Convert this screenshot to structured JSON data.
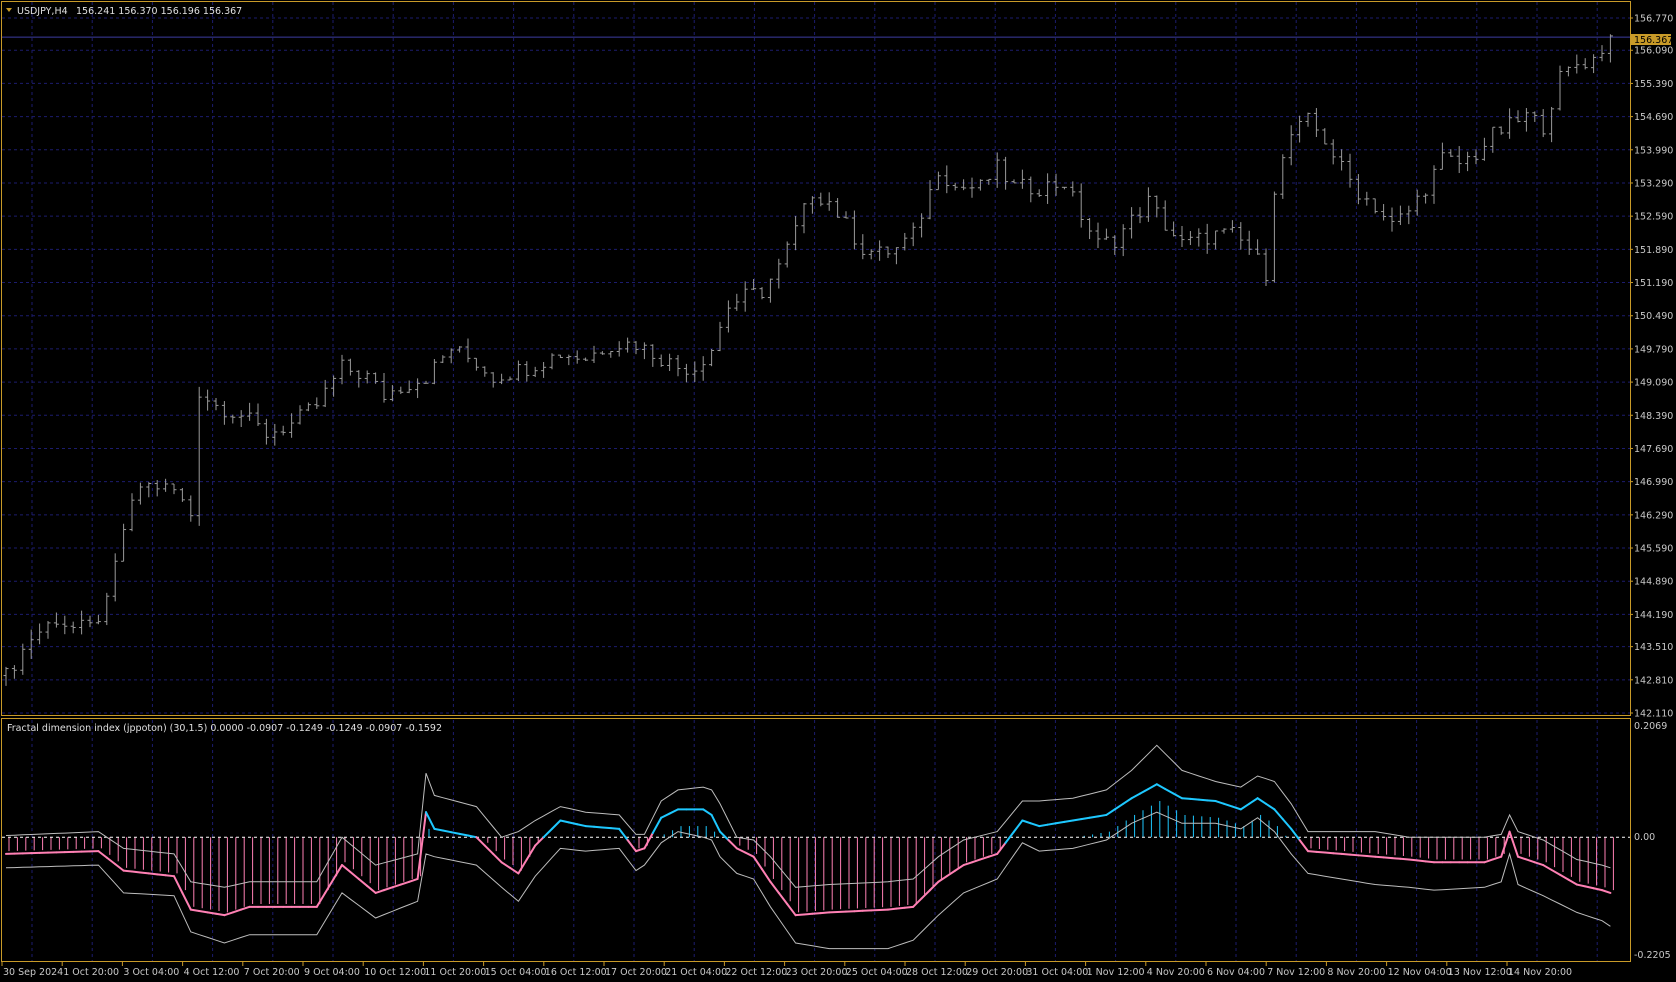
{
  "main": {
    "symbol": "USDJPY,H4",
    "ohlc": "156.241 156.370 156.196 156.367",
    "current_price": "156.367",
    "price_ticks": [
      "156.770",
      "156.090",
      "155.390",
      "154.690",
      "153.990",
      "153.290",
      "152.590",
      "151.890",
      "151.190",
      "150.490",
      "149.790",
      "149.090",
      "148.390",
      "147.690",
      "146.990",
      "146.290",
      "145.590",
      "144.890",
      "144.190",
      "143.510",
      "142.810",
      "142.110"
    ]
  },
  "indicator": {
    "title": "Fractal dimension index (jppoton) (30,1.5) 0.0000 -0.0907 -0.1249 -0.1249 -0.0907 -0.1592",
    "max_label": "0.2069",
    "zero_label": "0.00",
    "min_label": "-0.2205"
  },
  "time_labels": [
    "30 Sep 2024",
    "1 Oct 20:00",
    "3 Oct 04:00",
    "4 Oct 12:00",
    "7 Oct 20:00",
    "9 Oct 04:00",
    "10 Oct 12:00",
    "11 Oct 20:00",
    "15 Oct 04:00",
    "16 Oct 12:00",
    "17 Oct 20:00",
    "21 Oct 04:00",
    "22 Oct 12:00",
    "23 Oct 20:00",
    "25 Oct 04:00",
    "28 Oct 12:00",
    "29 Oct 20:00",
    "31 Oct 04:00",
    "1 Nov 12:00",
    "4 Nov 20:00",
    "6 Nov 04:00",
    "7 Nov 12:00",
    "8 Nov 20:00",
    "12 Nov 04:00",
    "13 Nov 12:00",
    "14 Nov 20:00"
  ],
  "colors": {
    "background": "#000000",
    "frame": "#c89a28",
    "grid": "#1c1c6e",
    "bars": "#9a9a9a",
    "bid_line": "#3c3ca0",
    "price_tag": "#c89a28",
    "fdi_positive": "#1ec8ff",
    "fdi_negative": "#ff80b4",
    "bands": "#bdbdbd",
    "zero_line": "#ffffff"
  },
  "chart_data": [
    {
      "type": "bar",
      "title": "USDJPY,H4",
      "ylim": [
        142.11,
        156.77
      ],
      "grid": true,
      "close_anchors": [
        [
          0,
          142.9
        ],
        [
          3,
          143.7
        ],
        [
          6,
          144.1
        ],
        [
          8,
          143.9
        ],
        [
          10,
          143.9
        ],
        [
          12,
          144.4
        ],
        [
          14,
          146.0
        ],
        [
          16,
          146.9
        ],
        [
          18,
          146.9
        ],
        [
          20,
          146.8
        ],
        [
          22,
          146.3
        ],
        [
          23,
          148.9
        ],
        [
          25,
          148.6
        ],
        [
          28,
          148.4
        ],
        [
          31,
          148.0
        ],
        [
          34,
          148.2
        ],
        [
          37,
          148.6
        ],
        [
          40,
          149.4
        ],
        [
          43,
          149.2
        ],
        [
          45,
          148.8
        ],
        [
          47,
          149.0
        ],
        [
          50,
          149.2
        ],
        [
          53,
          149.8
        ],
        [
          56,
          149.5
        ],
        [
          58,
          149.2
        ],
        [
          62,
          149.4
        ],
        [
          66,
          149.7
        ],
        [
          69,
          149.6
        ],
        [
          72,
          149.9
        ],
        [
          75,
          149.9
        ],
        [
          77,
          149.7
        ],
        [
          80,
          149.4
        ],
        [
          82,
          149.4
        ],
        [
          84,
          149.8
        ],
        [
          86,
          150.7
        ],
        [
          88,
          150.9
        ],
        [
          90,
          151.0
        ],
        [
          92,
          151.5
        ],
        [
          94,
          152.3
        ],
        [
          96,
          153.1
        ],
        [
          98,
          152.9
        ],
        [
          100,
          152.4
        ],
        [
          102,
          151.9
        ],
        [
          104,
          151.8
        ],
        [
          106,
          151.9
        ],
        [
          108,
          152.2
        ],
        [
          110,
          153.1
        ],
        [
          111,
          153.6
        ],
        [
          113,
          153.2
        ],
        [
          116,
          153.2
        ],
        [
          118,
          153.6
        ],
        [
          120,
          153.2
        ],
        [
          123,
          153.2
        ],
        [
          126,
          153.3
        ],
        [
          128,
          152.6
        ],
        [
          130,
          152.0
        ],
        [
          132,
          152.1
        ],
        [
          134,
          152.5
        ],
        [
          136,
          152.9
        ],
        [
          138,
          152.4
        ],
        [
          140,
          152.0
        ],
        [
          142,
          152.1
        ],
        [
          144,
          152.2
        ],
        [
          146,
          152.2
        ],
        [
          148,
          151.9
        ],
        [
          150,
          151.4
        ],
        [
          151,
          153.2
        ],
        [
          153,
          154.3
        ],
        [
          155,
          154.6
        ],
        [
          157,
          154.2
        ],
        [
          159,
          153.6
        ],
        [
          161,
          153.1
        ],
        [
          163,
          152.8
        ],
        [
          165,
          152.4
        ],
        [
          167,
          152.7
        ],
        [
          169,
          153.2
        ],
        [
          171,
          153.8
        ],
        [
          173,
          153.7
        ],
        [
          175,
          153.9
        ],
        [
          177,
          154.3
        ],
        [
          179,
          154.5
        ],
        [
          181,
          154.7
        ],
        [
          183,
          154.5
        ],
        [
          185,
          155.5
        ],
        [
          187,
          155.8
        ],
        [
          189,
          155.9
        ],
        [
          191,
          156.37
        ]
      ]
    },
    {
      "type": "line",
      "title": "Fractal dimension index (jppoton) (30,1.5)",
      "ylim": [
        -0.2205,
        0.2069
      ],
      "series": [
        {
          "values_anchors": [
            [
              0,
              -0.03
            ],
            [
              11,
              -0.025
            ],
            [
              14,
              -0.06
            ],
            [
              20,
              -0.07
            ],
            [
              22,
              -0.13
            ],
            [
              26,
              -0.14
            ],
            [
              29,
              -0.125
            ],
            [
              37,
              -0.125
            ],
            [
              40,
              -0.05
            ],
            [
              44,
              -0.1
            ],
            [
              49,
              -0.075
            ],
            [
              50,
              0.045
            ],
            [
              51,
              0.015
            ],
            [
              56,
              0.0
            ],
            [
              59,
              -0.045
            ],
            [
              61,
              -0.065
            ],
            [
              63,
              -0.015
            ],
            [
              66,
              0.03
            ],
            [
              69,
              0.02
            ],
            [
              73,
              0.015
            ],
            [
              75,
              -0.025
            ],
            [
              76,
              -0.02
            ],
            [
              78,
              0.035
            ],
            [
              80,
              0.05
            ],
            [
              83,
              0.05
            ],
            [
              84,
              0.04
            ],
            [
              85,
              0.01
            ],
            [
              87,
              -0.02
            ],
            [
              89,
              -0.035
            ],
            [
              91,
              -0.08
            ],
            [
              94,
              -0.14
            ],
            [
              98,
              -0.135
            ],
            [
              105,
              -0.13
            ],
            [
              108,
              -0.125
            ],
            [
              111,
              -0.08
            ],
            [
              114,
              -0.05
            ],
            [
              118,
              -0.03
            ],
            [
              121,
              0.03
            ],
            [
              123,
              0.02
            ],
            [
              127,
              0.03
            ],
            [
              131,
              0.04
            ],
            [
              134,
              0.07
            ],
            [
              137,
              0.095
            ],
            [
              140,
              0.07
            ],
            [
              144,
              0.065
            ],
            [
              147,
              0.05
            ],
            [
              149,
              0.07
            ],
            [
              151,
              0.05
            ],
            [
              153,
              0.015
            ],
            [
              155,
              -0.025
            ],
            [
              159,
              -0.03
            ],
            [
              163,
              -0.035
            ],
            [
              167,
              -0.04
            ],
            [
              170,
              -0.045
            ],
            [
              176,
              -0.045
            ],
            [
              178,
              -0.035
            ],
            [
              179,
              0.01
            ],
            [
              180,
              -0.035
            ],
            [
              183,
              -0.05
            ],
            [
              187,
              -0.085
            ],
            [
              190,
              -0.095
            ],
            [
              191,
              -0.1
            ]
          ]
        },
        {
          "name": "upper",
          "values_anchors": [
            [
              0,
              0.003
            ],
            [
              11,
              0.01
            ],
            [
              14,
              -0.02
            ],
            [
              20,
              -0.03
            ],
            [
              22,
              -0.08
            ],
            [
              26,
              -0.09
            ],
            [
              29,
              -0.08
            ],
            [
              37,
              -0.08
            ],
            [
              40,
              0.0
            ],
            [
              44,
              -0.05
            ],
            [
              49,
              -0.03
            ],
            [
              50,
              0.115
            ],
            [
              51,
              0.075
            ],
            [
              56,
              0.055
            ],
            [
              59,
              0.0
            ],
            [
              61,
              0.01
            ],
            [
              63,
              0.03
            ],
            [
              66,
              0.055
            ],
            [
              69,
              0.045
            ],
            [
              73,
              0.04
            ],
            [
              75,
              0.005
            ],
            [
              76,
              0.005
            ],
            [
              78,
              0.065
            ],
            [
              80,
              0.085
            ],
            [
              83,
              0.09
            ],
            [
              84,
              0.085
            ],
            [
              85,
              0.06
            ],
            [
              87,
              0.0
            ],
            [
              89,
              -0.005
            ],
            [
              91,
              -0.035
            ],
            [
              94,
              -0.09
            ],
            [
              98,
              -0.085
            ],
            [
              105,
              -0.08
            ],
            [
              108,
              -0.075
            ],
            [
              111,
              -0.035
            ],
            [
              114,
              -0.005
            ],
            [
              118,
              0.01
            ],
            [
              121,
              0.065
            ],
            [
              123,
              0.065
            ],
            [
              127,
              0.07
            ],
            [
              131,
              0.085
            ],
            [
              134,
              0.12
            ],
            [
              137,
              0.165
            ],
            [
              140,
              0.12
            ],
            [
              144,
              0.1
            ],
            [
              147,
              0.09
            ],
            [
              149,
              0.11
            ],
            [
              151,
              0.1
            ],
            [
              153,
              0.06
            ],
            [
              155,
              0.01
            ],
            [
              159,
              0.01
            ],
            [
              163,
              0.01
            ],
            [
              167,
              0.0
            ],
            [
              170,
              0.0
            ],
            [
              176,
              0.0
            ],
            [
              178,
              0.005
            ],
            [
              179,
              0.04
            ],
            [
              180,
              0.01
            ],
            [
              183,
              -0.005
            ],
            [
              187,
              -0.04
            ],
            [
              190,
              -0.05
            ],
            [
              191,
              -0.055
            ]
          ]
        },
        {
          "name": "lower",
          "values_anchors": [
            [
              0,
              -0.055
            ],
            [
              11,
              -0.05
            ],
            [
              14,
              -0.1
            ],
            [
              20,
              -0.105
            ],
            [
              22,
              -0.17
            ],
            [
              26,
              -0.19
            ],
            [
              29,
              -0.175
            ],
            [
              37,
              -0.175
            ],
            [
              40,
              -0.1
            ],
            [
              44,
              -0.145
            ],
            [
              49,
              -0.115
            ],
            [
              50,
              -0.03
            ],
            [
              51,
              -0.035
            ],
            [
              56,
              -0.05
            ],
            [
              59,
              -0.09
            ],
            [
              61,
              -0.115
            ],
            [
              63,
              -0.07
            ],
            [
              66,
              -0.02
            ],
            [
              69,
              -0.025
            ],
            [
              73,
              -0.02
            ],
            [
              75,
              -0.06
            ],
            [
              76,
              -0.05
            ],
            [
              78,
              -0.01
            ],
            [
              80,
              0.01
            ],
            [
              83,
              0.0
            ],
            [
              84,
              -0.005
            ],
            [
              85,
              -0.035
            ],
            [
              87,
              -0.065
            ],
            [
              89,
              -0.075
            ],
            [
              91,
              -0.125
            ],
            [
              94,
              -0.19
            ],
            [
              98,
              -0.2
            ],
            [
              105,
              -0.2
            ],
            [
              108,
              -0.185
            ],
            [
              111,
              -0.14
            ],
            [
              114,
              -0.1
            ],
            [
              118,
              -0.075
            ],
            [
              121,
              -0.01
            ],
            [
              123,
              -0.025
            ],
            [
              127,
              -0.02
            ],
            [
              131,
              -0.005
            ],
            [
              134,
              0.025
            ],
            [
              137,
              0.045
            ],
            [
              140,
              0.025
            ],
            [
              144,
              0.025
            ],
            [
              147,
              0.015
            ],
            [
              149,
              0.035
            ],
            [
              151,
              0.01
            ],
            [
              153,
              -0.03
            ],
            [
              155,
              -0.065
            ],
            [
              159,
              -0.075
            ],
            [
              163,
              -0.085
            ],
            [
              167,
              -0.09
            ],
            [
              170,
              -0.095
            ],
            [
              176,
              -0.09
            ],
            [
              178,
              -0.08
            ],
            [
              179,
              -0.03
            ],
            [
              180,
              -0.085
            ],
            [
              183,
              -0.105
            ],
            [
              187,
              -0.135
            ],
            [
              190,
              -0.15
            ],
            [
              191,
              -0.16
            ]
          ]
        }
      ]
    }
  ]
}
